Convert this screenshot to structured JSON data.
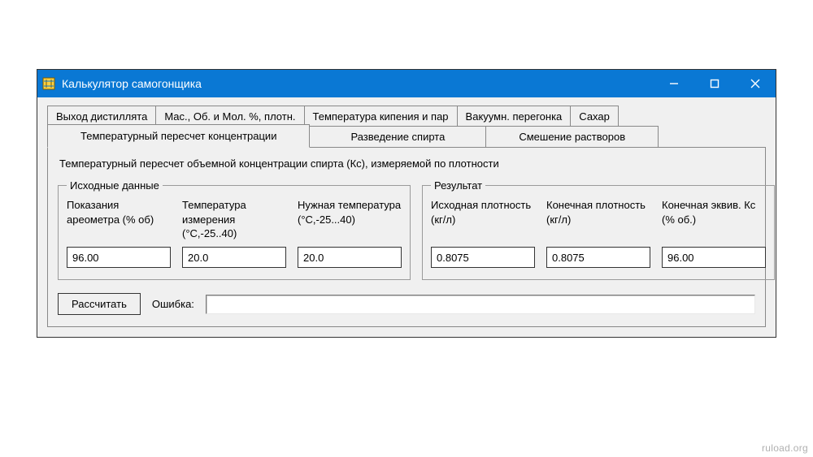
{
  "window": {
    "title": "Калькулятор самогонщика"
  },
  "tabs_back": [
    "Выход дистиллята",
    "Мас., Об. и Мол. %, плотн.",
    "Температура кипения и пар",
    "Вакуумн. перегонка",
    "Сахар"
  ],
  "tabs_front": [
    "Температурный пересчет концентрации",
    "Разведение спирта",
    "Смешение растворов"
  ],
  "active_tab": "Температурный пересчет концентрации",
  "panel": {
    "description": "Температурный пересчет объемной концентрации спирта (Кс), измеряемой по плотности",
    "source_group": {
      "legend": "Исходные данные",
      "fields": [
        {
          "label": "Показания ареометра (% об)",
          "value": "96.00"
        },
        {
          "label": "Температура измерения (°С,-25..40)",
          "value": "20.0"
        },
        {
          "label": "Нужная температура (°С,-25...40)",
          "value": "20.0"
        }
      ]
    },
    "result_group": {
      "legend": "Результат",
      "fields": [
        {
          "label": "Исходная плотность (кг/л)",
          "value": "0.8075"
        },
        {
          "label": "Конечная плотность (кг/л)",
          "value": "0.8075"
        },
        {
          "label": "Конечная эквив. Кс (% об.)",
          "value": "96.00"
        }
      ]
    },
    "calc_button": "Рассчитать",
    "error_label": "Ошибка:",
    "error_value": ""
  },
  "watermark": "ruload.org"
}
